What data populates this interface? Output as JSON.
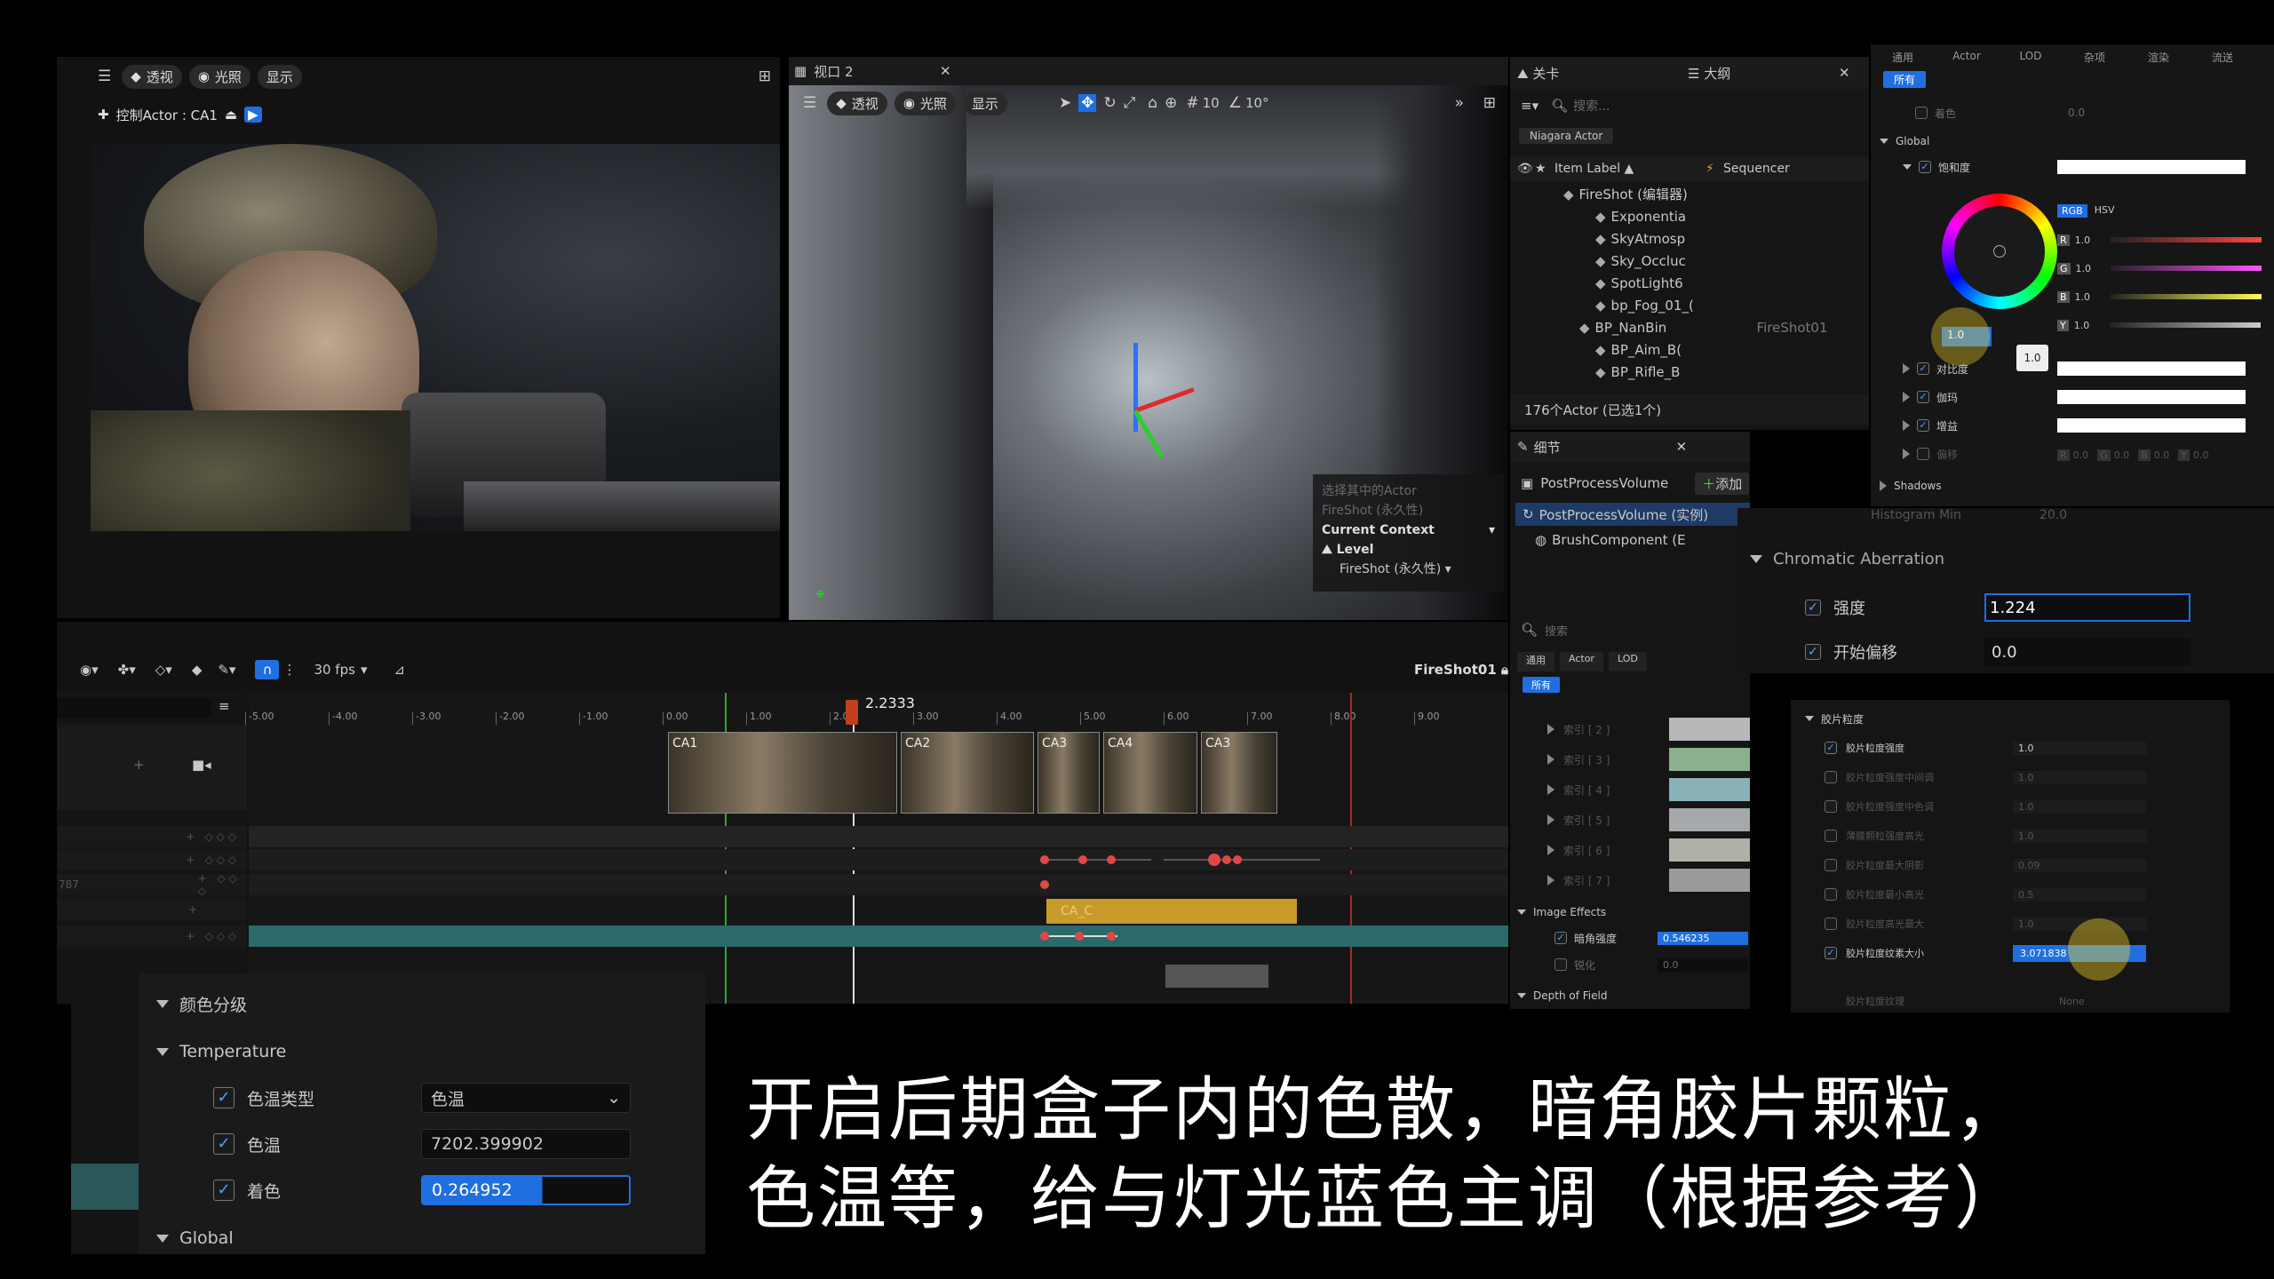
{
  "viewport1": {
    "view_label": "透视",
    "light_label": "光照",
    "show_label": "显示",
    "pilot_label": "控制Actor : CA1"
  },
  "viewport2": {
    "tab_title": "视口 2",
    "view_label": "透视",
    "light_label": "光照",
    "show_label": "显示",
    "grid_value": "10",
    "angle_value": "10°",
    "overlay": {
      "select_text": "选择其中的Actor",
      "fireshot_text": "FireShot (永久性)",
      "context_label": "Current Context",
      "level_label": "Level",
      "level_value": "FireShot (永久性)"
    }
  },
  "outliner": {
    "tab_level": "关卡",
    "tab_outline": "大纲",
    "search_placeholder": "搜索...",
    "filter_chip": "Niagara Actor",
    "col_item": "Item Label ▲",
    "col_seq": "Sequencer",
    "items": [
      {
        "label": "FireShot (编辑器)",
        "extra": ""
      },
      {
        "label": "Exponentia",
        "extra": ""
      },
      {
        "label": "SkyAtmosp",
        "extra": ""
      },
      {
        "label": "Sky_Occluc",
        "extra": ""
      },
      {
        "label": "SpotLight6",
        "extra": ""
      },
      {
        "label": "bp_Fog_01_(",
        "extra": ""
      },
      {
        "label": "BP_NanBin",
        "extra": "FireShot01"
      },
      {
        "label": "BP_Aim_B(",
        "extra": ""
      },
      {
        "label": "BP_Rifle_B",
        "extra": ""
      }
    ],
    "count": "176个Actor (已选1个)"
  },
  "details": {
    "tab": "细节",
    "actor_name": "PostProcessVolume",
    "add_label": "添加",
    "component_root": "PostProcessVolume (实例)",
    "component_child": "BrushComponent (E",
    "search_placeholder": "搜索",
    "tabs": [
      "通用",
      "Actor",
      "LOD"
    ],
    "all_label": "所有",
    "rows": [
      "索引 [ 2 ]",
      "索引 [ 3 ]",
      "索引 [ 4 ]",
      "索引 [ 5 ]",
      "索引 [ 6 ]",
      "索引 [ 7 ]"
    ],
    "image_effects": "Image Effects",
    "vignette_label": "暗角强度",
    "vignette_value": "0.546235",
    "sharpen_label": "锐化",
    "sharpen_value": "0.0",
    "dof": "Depth of Field"
  },
  "color_panel": {
    "tabs": [
      "通用",
      "Actor",
      "LOD",
      "杂项",
      "渲染",
      "流送"
    ],
    "all_label": "所有",
    "tint_label": "着色",
    "tint_value": "0.0",
    "global": "Global",
    "saturation": "饱和度",
    "rgb": "RGB",
    "hsv": "HSV",
    "channels": [
      {
        "k": "R",
        "v": "1.0"
      },
      {
        "k": "G",
        "v": "1.0"
      },
      {
        "k": "B",
        "v": "1.0"
      },
      {
        "k": "Y",
        "v": "1.0"
      }
    ],
    "wheel_value": "1.0",
    "tooltip": "1.0",
    "contrast": "对比度",
    "gamma": "伽玛",
    "gain": "增益",
    "offset": "偏移",
    "bottom_values": [
      {
        "k": "R",
        "v": "0.0"
      },
      {
        "k": "G",
        "v": "0.0"
      },
      {
        "k": "B",
        "v": "0.0"
      },
      {
        "k": "Y",
        "v": "0.0"
      }
    ],
    "shadows": "Shadows"
  },
  "chromatic": {
    "histogram": "Histogram Min",
    "histogram_value": "20.0",
    "section": "Chromatic Aberration",
    "intensity_label": "强度",
    "intensity_value": "1.224",
    "offset_label": "开始偏移",
    "offset_value": "0.0"
  },
  "grain": {
    "section": "胶片粒度",
    "rows": [
      {
        "label": "胶片粒度强度",
        "value": "1.0",
        "on": true
      },
      {
        "label": "胶片粒度强度中间调",
        "value": "1.0",
        "on": false
      },
      {
        "label": "胶片粒度强度中色调",
        "value": "1.0",
        "on": false
      },
      {
        "label": "薄膜颗粒强度高光",
        "value": "1.0",
        "on": false
      },
      {
        "label": "胶片粒度最大阴影",
        "value": "0.09",
        "on": false
      },
      {
        "label": "胶片粒度最小高光",
        "value": "0.5",
        "on": false
      },
      {
        "label": "胶片粒度高光最大",
        "value": "1.0",
        "on": false
      },
      {
        "label": "胶片粒度纹素大小",
        "value": "3.071838",
        "on": true
      }
    ],
    "bottom_label": "胶片粒度纹理",
    "bottom_value": "None"
  },
  "sequencer": {
    "fps": "30 fps",
    "sequence_name": "FireShot01",
    "playhead": "2.2333",
    "ticks": [
      "-5.00",
      "-4.00",
      "-3.00",
      "-2.00",
      "-1.00",
      "0.00",
      "1.00",
      "2.00",
      "3.00",
      "4.00",
      "5.00",
      "6.00",
      "7.00",
      "8.00",
      "9.00"
    ],
    "shots": [
      "CA1",
      "CA2",
      "CA3",
      "CA4",
      "CA3"
    ],
    "track_value": "787",
    "bar_label": "CA_C"
  },
  "grading": {
    "section": "颜色分级",
    "temperature": "Temperature",
    "type_label": "色温类型",
    "type_value": "色温",
    "temp_label": "色温",
    "temp_value": "7202.399902",
    "tint_label": "着色",
    "tint_value": "0.264952",
    "global": "Global"
  },
  "caption": {
    "line1": "开启后期盒子内的色散，暗角胶片颗粒，",
    "line2": "色温等，给与灯光蓝色主调（根据参考）"
  }
}
